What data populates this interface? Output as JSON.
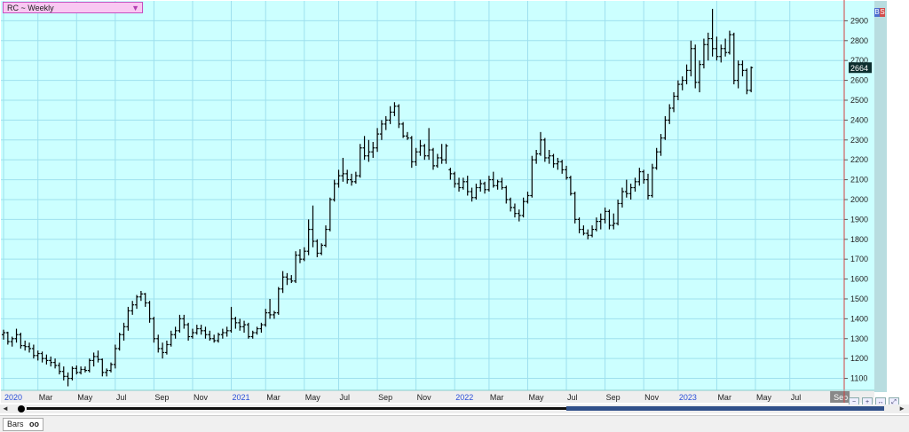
{
  "header": {
    "symbol_label": "RC ~ Weekly",
    "dropdown_glyph": "▼"
  },
  "badge": {
    "b": "B",
    "s": "S"
  },
  "status": {
    "tab_label": "Bars",
    "tab_icon": "oo"
  },
  "scroll": {
    "left_glyph": "◄",
    "right_glyph": "►"
  },
  "toolbar": {
    "icons": [
      "zoom-out-icon",
      "zoom-in-icon",
      "fit-icon",
      "expand-icon"
    ]
  },
  "colors": {
    "plot_bg": "#ccffff",
    "grid": "#9ee0ee",
    "bars": "#000000",
    "price_tag_bg": "#0d2e2e",
    "red_line": "#d14040"
  },
  "chart_data": {
    "type": "ohlc",
    "x_ticks": [
      {
        "label": "2020",
        "i": 0,
        "year": true
      },
      {
        "label": "Mar",
        "i": 8
      },
      {
        "label": "May",
        "i": 17
      },
      {
        "label": "Jul",
        "i": 26
      },
      {
        "label": "Sep",
        "i": 35
      },
      {
        "label": "Nov",
        "i": 44
      },
      {
        "label": "2021",
        "i": 53,
        "year": true
      },
      {
        "label": "Mar",
        "i": 61
      },
      {
        "label": "May",
        "i": 70
      },
      {
        "label": "Jul",
        "i": 78
      },
      {
        "label": "Sep",
        "i": 87
      },
      {
        "label": "Nov",
        "i": 96
      },
      {
        "label": "2022",
        "i": 105,
        "year": true
      },
      {
        "label": "Mar",
        "i": 113
      },
      {
        "label": "May",
        "i": 122
      },
      {
        "label": "Jul",
        "i": 131
      },
      {
        "label": "Sep",
        "i": 140
      },
      {
        "label": "Nov",
        "i": 149
      },
      {
        "label": "2023",
        "i": 157,
        "year": true
      },
      {
        "label": "Mar",
        "i": 166
      },
      {
        "label": "May",
        "i": 175
      },
      {
        "label": "Jul",
        "i": 183
      },
      {
        "label": "Sep",
        "i": 193,
        "current": true
      }
    ],
    "y_ticks": [
      1100,
      1200,
      1300,
      1400,
      1500,
      1600,
      1700,
      1800,
      1900,
      2000,
      2100,
      2200,
      2300,
      2400,
      2500,
      2600,
      2700,
      2800,
      2900
    ],
    "ylim": [
      1040,
      3000
    ],
    "last_price": "2664",
    "ohlc": [
      {
        "o": 1320,
        "h": 1345,
        "l": 1295,
        "c": 1330
      },
      {
        "o": 1330,
        "h": 1335,
        "l": 1270,
        "c": 1285
      },
      {
        "o": 1285,
        "h": 1310,
        "l": 1260,
        "c": 1300
      },
      {
        "o": 1300,
        "h": 1350,
        "l": 1280,
        "c": 1320
      },
      {
        "o": 1320,
        "h": 1330,
        "l": 1250,
        "c": 1265
      },
      {
        "o": 1265,
        "h": 1290,
        "l": 1240,
        "c": 1260
      },
      {
        "o": 1260,
        "h": 1280,
        "l": 1230,
        "c": 1250
      },
      {
        "o": 1250,
        "h": 1270,
        "l": 1200,
        "c": 1215
      },
      {
        "o": 1215,
        "h": 1240,
        "l": 1190,
        "c": 1225
      },
      {
        "o": 1225,
        "h": 1235,
        "l": 1180,
        "c": 1200
      },
      {
        "o": 1200,
        "h": 1220,
        "l": 1170,
        "c": 1190
      },
      {
        "o": 1190,
        "h": 1210,
        "l": 1160,
        "c": 1180
      },
      {
        "o": 1180,
        "h": 1200,
        "l": 1150,
        "c": 1165
      },
      {
        "o": 1165,
        "h": 1180,
        "l": 1120,
        "c": 1135
      },
      {
        "o": 1135,
        "h": 1160,
        "l": 1090,
        "c": 1110
      },
      {
        "o": 1110,
        "h": 1130,
        "l": 1060,
        "c": 1100
      },
      {
        "o": 1100,
        "h": 1160,
        "l": 1090,
        "c": 1150
      },
      {
        "o": 1150,
        "h": 1165,
        "l": 1120,
        "c": 1130
      },
      {
        "o": 1130,
        "h": 1160,
        "l": 1120,
        "c": 1145
      },
      {
        "o": 1145,
        "h": 1160,
        "l": 1130,
        "c": 1140
      },
      {
        "o": 1140,
        "h": 1200,
        "l": 1130,
        "c": 1190
      },
      {
        "o": 1190,
        "h": 1230,
        "l": 1160,
        "c": 1210
      },
      {
        "o": 1210,
        "h": 1240,
        "l": 1180,
        "c": 1195
      },
      {
        "o": 1195,
        "h": 1200,
        "l": 1110,
        "c": 1130
      },
      {
        "o": 1130,
        "h": 1150,
        "l": 1110,
        "c": 1140
      },
      {
        "o": 1140,
        "h": 1180,
        "l": 1130,
        "c": 1170
      },
      {
        "o": 1170,
        "h": 1270,
        "l": 1150,
        "c": 1250
      },
      {
        "o": 1250,
        "h": 1330,
        "l": 1240,
        "c": 1320
      },
      {
        "o": 1320,
        "h": 1380,
        "l": 1290,
        "c": 1360
      },
      {
        "o": 1360,
        "h": 1460,
        "l": 1340,
        "c": 1440
      },
      {
        "o": 1440,
        "h": 1490,
        "l": 1420,
        "c": 1470
      },
      {
        "o": 1470,
        "h": 1520,
        "l": 1450,
        "c": 1510
      },
      {
        "o": 1510,
        "h": 1540,
        "l": 1490,
        "c": 1525
      },
      {
        "o": 1525,
        "h": 1530,
        "l": 1460,
        "c": 1480
      },
      {
        "o": 1480,
        "h": 1490,
        "l": 1380,
        "c": 1400
      },
      {
        "o": 1400,
        "h": 1410,
        "l": 1280,
        "c": 1300
      },
      {
        "o": 1300,
        "h": 1320,
        "l": 1230,
        "c": 1250
      },
      {
        "o": 1250,
        "h": 1280,
        "l": 1200,
        "c": 1230
      },
      {
        "o": 1230,
        "h": 1290,
        "l": 1220,
        "c": 1270
      },
      {
        "o": 1270,
        "h": 1340,
        "l": 1260,
        "c": 1320
      },
      {
        "o": 1320,
        "h": 1360,
        "l": 1300,
        "c": 1340
      },
      {
        "o": 1340,
        "h": 1420,
        "l": 1330,
        "c": 1400
      },
      {
        "o": 1400,
        "h": 1420,
        "l": 1350,
        "c": 1370
      },
      {
        "o": 1370,
        "h": 1380,
        "l": 1290,
        "c": 1310
      },
      {
        "o": 1310,
        "h": 1350,
        "l": 1300,
        "c": 1330
      },
      {
        "o": 1330,
        "h": 1370,
        "l": 1320,
        "c": 1350
      },
      {
        "o": 1350,
        "h": 1370,
        "l": 1320,
        "c": 1340
      },
      {
        "o": 1340,
        "h": 1360,
        "l": 1300,
        "c": 1320
      },
      {
        "o": 1320,
        "h": 1340,
        "l": 1290,
        "c": 1300
      },
      {
        "o": 1300,
        "h": 1320,
        "l": 1280,
        "c": 1290
      },
      {
        "o": 1290,
        "h": 1330,
        "l": 1280,
        "c": 1320
      },
      {
        "o": 1320,
        "h": 1350,
        "l": 1300,
        "c": 1330
      },
      {
        "o": 1330,
        "h": 1360,
        "l": 1310,
        "c": 1340
      },
      {
        "o": 1340,
        "h": 1460,
        "l": 1330,
        "c": 1400
      },
      {
        "o": 1400,
        "h": 1410,
        "l": 1350,
        "c": 1380
      },
      {
        "o": 1380,
        "h": 1400,
        "l": 1340,
        "c": 1360
      },
      {
        "o": 1360,
        "h": 1390,
        "l": 1330,
        "c": 1370
      },
      {
        "o": 1370,
        "h": 1380,
        "l": 1300,
        "c": 1310
      },
      {
        "o": 1310,
        "h": 1340,
        "l": 1300,
        "c": 1330
      },
      {
        "o": 1330,
        "h": 1360,
        "l": 1320,
        "c": 1350
      },
      {
        "o": 1350,
        "h": 1380,
        "l": 1330,
        "c": 1370
      },
      {
        "o": 1370,
        "h": 1450,
        "l": 1360,
        "c": 1430
      },
      {
        "o": 1430,
        "h": 1500,
        "l": 1400,
        "c": 1420
      },
      {
        "o": 1420,
        "h": 1440,
        "l": 1400,
        "c": 1430
      },
      {
        "o": 1430,
        "h": 1560,
        "l": 1420,
        "c": 1550
      },
      {
        "o": 1550,
        "h": 1640,
        "l": 1530,
        "c": 1610
      },
      {
        "o": 1610,
        "h": 1630,
        "l": 1570,
        "c": 1600
      },
      {
        "o": 1600,
        "h": 1620,
        "l": 1580,
        "c": 1590
      },
      {
        "o": 1590,
        "h": 1740,
        "l": 1580,
        "c": 1720
      },
      {
        "o": 1720,
        "h": 1750,
        "l": 1680,
        "c": 1700
      },
      {
        "o": 1700,
        "h": 1760,
        "l": 1690,
        "c": 1740
      },
      {
        "o": 1740,
        "h": 1900,
        "l": 1720,
        "c": 1850
      },
      {
        "o": 1850,
        "h": 1970,
        "l": 1760,
        "c": 1790
      },
      {
        "o": 1790,
        "h": 1800,
        "l": 1710,
        "c": 1730
      },
      {
        "o": 1730,
        "h": 1780,
        "l": 1720,
        "c": 1770
      },
      {
        "o": 1770,
        "h": 1870,
        "l": 1760,
        "c": 1850
      },
      {
        "o": 1850,
        "h": 2010,
        "l": 1840,
        "c": 2000
      },
      {
        "o": 2000,
        "h": 2100,
        "l": 1990,
        "c": 2080
      },
      {
        "o": 2080,
        "h": 2150,
        "l": 2060,
        "c": 2120
      },
      {
        "o": 2120,
        "h": 2210,
        "l": 2090,
        "c": 2130
      },
      {
        "o": 2130,
        "h": 2150,
        "l": 2080,
        "c": 2100
      },
      {
        "o": 2100,
        "h": 2130,
        "l": 2070,
        "c": 2090
      },
      {
        "o": 2090,
        "h": 2140,
        "l": 2080,
        "c": 2120
      },
      {
        "o": 2120,
        "h": 2280,
        "l": 2110,
        "c": 2260
      },
      {
        "o": 2260,
        "h": 2320,
        "l": 2200,
        "c": 2220
      },
      {
        "o": 2220,
        "h": 2300,
        "l": 2190,
        "c": 2240
      },
      {
        "o": 2240,
        "h": 2290,
        "l": 2210,
        "c": 2260
      },
      {
        "o": 2260,
        "h": 2360,
        "l": 2240,
        "c": 2330
      },
      {
        "o": 2330,
        "h": 2400,
        "l": 2300,
        "c": 2380
      },
      {
        "o": 2380,
        "h": 2420,
        "l": 2350,
        "c": 2400
      },
      {
        "o": 2400,
        "h": 2470,
        "l": 2380,
        "c": 2440
      },
      {
        "o": 2440,
        "h": 2490,
        "l": 2420,
        "c": 2470
      },
      {
        "o": 2470,
        "h": 2480,
        "l": 2360,
        "c": 2380
      },
      {
        "o": 2380,
        "h": 2390,
        "l": 2310,
        "c": 2320
      },
      {
        "o": 2320,
        "h": 2340,
        "l": 2300,
        "c": 2310
      },
      {
        "o": 2310,
        "h": 2320,
        "l": 2160,
        "c": 2190
      },
      {
        "o": 2190,
        "h": 2260,
        "l": 2170,
        "c": 2240
      },
      {
        "o": 2240,
        "h": 2300,
        "l": 2220,
        "c": 2270
      },
      {
        "o": 2270,
        "h": 2280,
        "l": 2200,
        "c": 2220
      },
      {
        "o": 2220,
        "h": 2360,
        "l": 2200,
        "c": 2250
      },
      {
        "o": 2250,
        "h": 2260,
        "l": 2150,
        "c": 2170
      },
      {
        "o": 2170,
        "h": 2230,
        "l": 2160,
        "c": 2210
      },
      {
        "o": 2210,
        "h": 2280,
        "l": 2180,
        "c": 2200
      },
      {
        "o": 2200,
        "h": 2280,
        "l": 2180,
        "c": 2270
      },
      {
        "o": 2150,
        "h": 2160,
        "l": 2100,
        "c": 2130
      },
      {
        "o": 2130,
        "h": 2140,
        "l": 2060,
        "c": 2080
      },
      {
        "o": 2080,
        "h": 2110,
        "l": 2040,
        "c": 2060
      },
      {
        "o": 2060,
        "h": 2110,
        "l": 2050,
        "c": 2090
      },
      {
        "o": 2090,
        "h": 2120,
        "l": 2020,
        "c": 2040
      },
      {
        "o": 2040,
        "h": 2060,
        "l": 1990,
        "c": 2010
      },
      {
        "o": 2010,
        "h": 2080,
        "l": 2000,
        "c": 2060
      },
      {
        "o": 2060,
        "h": 2100,
        "l": 2040,
        "c": 2080
      },
      {
        "o": 2080,
        "h": 2090,
        "l": 2030,
        "c": 2050
      },
      {
        "o": 2050,
        "h": 2120,
        "l": 2040,
        "c": 2100
      },
      {
        "o": 2100,
        "h": 2140,
        "l": 2060,
        "c": 2070
      },
      {
        "o": 2070,
        "h": 2100,
        "l": 2050,
        "c": 2090
      },
      {
        "o": 2090,
        "h": 2110,
        "l": 2050,
        "c": 2060
      },
      {
        "o": 2060,
        "h": 2070,
        "l": 1980,
        "c": 2000
      },
      {
        "o": 2000,
        "h": 2010,
        "l": 1940,
        "c": 1960
      },
      {
        "o": 1960,
        "h": 1980,
        "l": 1910,
        "c": 1930
      },
      {
        "o": 1930,
        "h": 1950,
        "l": 1890,
        "c": 1920
      },
      {
        "o": 1920,
        "h": 2010,
        "l": 1910,
        "c": 1990
      },
      {
        "o": 1990,
        "h": 2040,
        "l": 1980,
        "c": 2020
      },
      {
        "o": 2020,
        "h": 2220,
        "l": 2010,
        "c": 2200
      },
      {
        "o": 2200,
        "h": 2250,
        "l": 2180,
        "c": 2230
      },
      {
        "o": 2230,
        "h": 2340,
        "l": 2220,
        "c": 2300
      },
      {
        "o": 2300,
        "h": 2310,
        "l": 2190,
        "c": 2210
      },
      {
        "o": 2210,
        "h": 2250,
        "l": 2180,
        "c": 2220
      },
      {
        "o": 2220,
        "h": 2230,
        "l": 2160,
        "c": 2180
      },
      {
        "o": 2180,
        "h": 2210,
        "l": 2150,
        "c": 2190
      },
      {
        "o": 2190,
        "h": 2200,
        "l": 2130,
        "c": 2150
      },
      {
        "o": 2150,
        "h": 2170,
        "l": 2100,
        "c": 2110
      },
      {
        "o": 2110,
        "h": 2120,
        "l": 2020,
        "c": 2030
      },
      {
        "o": 2030,
        "h": 2040,
        "l": 1880,
        "c": 1900
      },
      {
        "o": 1900,
        "h": 1910,
        "l": 1830,
        "c": 1850
      },
      {
        "o": 1850,
        "h": 1870,
        "l": 1820,
        "c": 1830
      },
      {
        "o": 1830,
        "h": 1850,
        "l": 1800,
        "c": 1820
      },
      {
        "o": 1820,
        "h": 1870,
        "l": 1810,
        "c": 1850
      },
      {
        "o": 1850,
        "h": 1910,
        "l": 1840,
        "c": 1890
      },
      {
        "o": 1890,
        "h": 1930,
        "l": 1850,
        "c": 1900
      },
      {
        "o": 1900,
        "h": 1960,
        "l": 1880,
        "c": 1940
      },
      {
        "o": 1940,
        "h": 1950,
        "l": 1850,
        "c": 1870
      },
      {
        "o": 1870,
        "h": 1930,
        "l": 1850,
        "c": 1880
      },
      {
        "o": 1880,
        "h": 2000,
        "l": 1870,
        "c": 1980
      },
      {
        "o": 1980,
        "h": 2060,
        "l": 1960,
        "c": 2040
      },
      {
        "o": 2040,
        "h": 2100,
        "l": 2010,
        "c": 2030
      },
      {
        "o": 2030,
        "h": 2080,
        "l": 2000,
        "c": 2060
      },
      {
        "o": 2060,
        "h": 2110,
        "l": 2040,
        "c": 2090
      },
      {
        "o": 2090,
        "h": 2160,
        "l": 2070,
        "c": 2140
      },
      {
        "o": 2140,
        "h": 2150,
        "l": 2080,
        "c": 2100
      },
      {
        "o": 2100,
        "h": 2130,
        "l": 2000,
        "c": 2020
      },
      {
        "o": 2020,
        "h": 2180,
        "l": 2010,
        "c": 2160
      },
      {
        "o": 2160,
        "h": 2260,
        "l": 2150,
        "c": 2240
      },
      {
        "o": 2240,
        "h": 2330,
        "l": 2220,
        "c": 2310
      },
      {
        "o": 2310,
        "h": 2420,
        "l": 2300,
        "c": 2400
      },
      {
        "o": 2400,
        "h": 2480,
        "l": 2380,
        "c": 2460
      },
      {
        "o": 2460,
        "h": 2540,
        "l": 2440,
        "c": 2520
      },
      {
        "o": 2520,
        "h": 2600,
        "l": 2500,
        "c": 2580
      },
      {
        "o": 2580,
        "h": 2620,
        "l": 2550,
        "c": 2600
      },
      {
        "o": 2600,
        "h": 2680,
        "l": 2580,
        "c": 2650
      },
      {
        "o": 2650,
        "h": 2800,
        "l": 2620,
        "c": 2760
      },
      {
        "o": 2760,
        "h": 2780,
        "l": 2560,
        "c": 2590
      },
      {
        "o": 2590,
        "h": 2700,
        "l": 2540,
        "c": 2680
      },
      {
        "o": 2680,
        "h": 2810,
        "l": 2660,
        "c": 2780
      },
      {
        "o": 2780,
        "h": 2840,
        "l": 2700,
        "c": 2810
      },
      {
        "o": 2810,
        "h": 2960,
        "l": 2720,
        "c": 2760
      },
      {
        "o": 2760,
        "h": 2820,
        "l": 2700,
        "c": 2720
      },
      {
        "o": 2720,
        "h": 2780,
        "l": 2690,
        "c": 2760
      },
      {
        "o": 2760,
        "h": 2810,
        "l": 2720,
        "c": 2740
      },
      {
        "o": 2740,
        "h": 2850,
        "l": 2730,
        "c": 2830
      },
      {
        "o": 2830,
        "h": 2840,
        "l": 2580,
        "c": 2600
      },
      {
        "o": 2600,
        "h": 2700,
        "l": 2560,
        "c": 2680
      },
      {
        "o": 2680,
        "h": 2700,
        "l": 2620,
        "c": 2650
      },
      {
        "o": 2650,
        "h": 2660,
        "l": 2530,
        "c": 2550
      },
      {
        "o": 2550,
        "h": 2670,
        "l": 2540,
        "c": 2664
      }
    ]
  }
}
